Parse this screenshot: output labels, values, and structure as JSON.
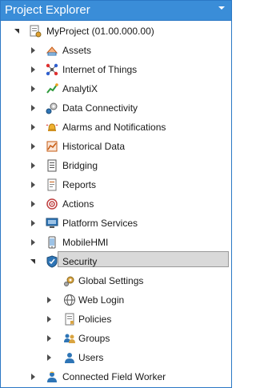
{
  "panel": {
    "title": "Project Explorer"
  },
  "tree": {
    "root": {
      "label": "MyProject (01.00.000.00)"
    },
    "items": [
      {
        "label": "Assets"
      },
      {
        "label": "Internet of Things"
      },
      {
        "label": "AnalytiX"
      },
      {
        "label": "Data Connectivity"
      },
      {
        "label": "Alarms and Notifications"
      },
      {
        "label": "Historical Data"
      },
      {
        "label": "Bridging"
      },
      {
        "label": "Reports"
      },
      {
        "label": "Actions"
      },
      {
        "label": "Platform Services"
      },
      {
        "label": "MobileHMI"
      },
      {
        "label": "Security"
      }
    ],
    "security_children": [
      {
        "label": "Global Settings",
        "selected": true
      },
      {
        "label": "Web Login"
      },
      {
        "label": "Policies"
      },
      {
        "label": "Groups"
      },
      {
        "label": "Users"
      }
    ],
    "last_item": {
      "label": "Connected Field Worker"
    }
  },
  "icons": {
    "root": "project-icon",
    "items": [
      "assets-icon",
      "iot-icon",
      "analytix-icon",
      "data-connectivity-icon",
      "alarms-icon",
      "historical-data-icon",
      "bridging-icon",
      "reports-icon",
      "actions-icon",
      "platform-services-icon",
      "mobilehmi-icon",
      "security-shield-icon"
    ],
    "security_children": [
      "gear-icon",
      "web-login-icon",
      "policies-icon",
      "groups-icon",
      "users-icon"
    ],
    "last_item": "field-worker-icon"
  },
  "colors": {
    "header": "#3a8dd8",
    "selection": "#d9d9d9"
  }
}
